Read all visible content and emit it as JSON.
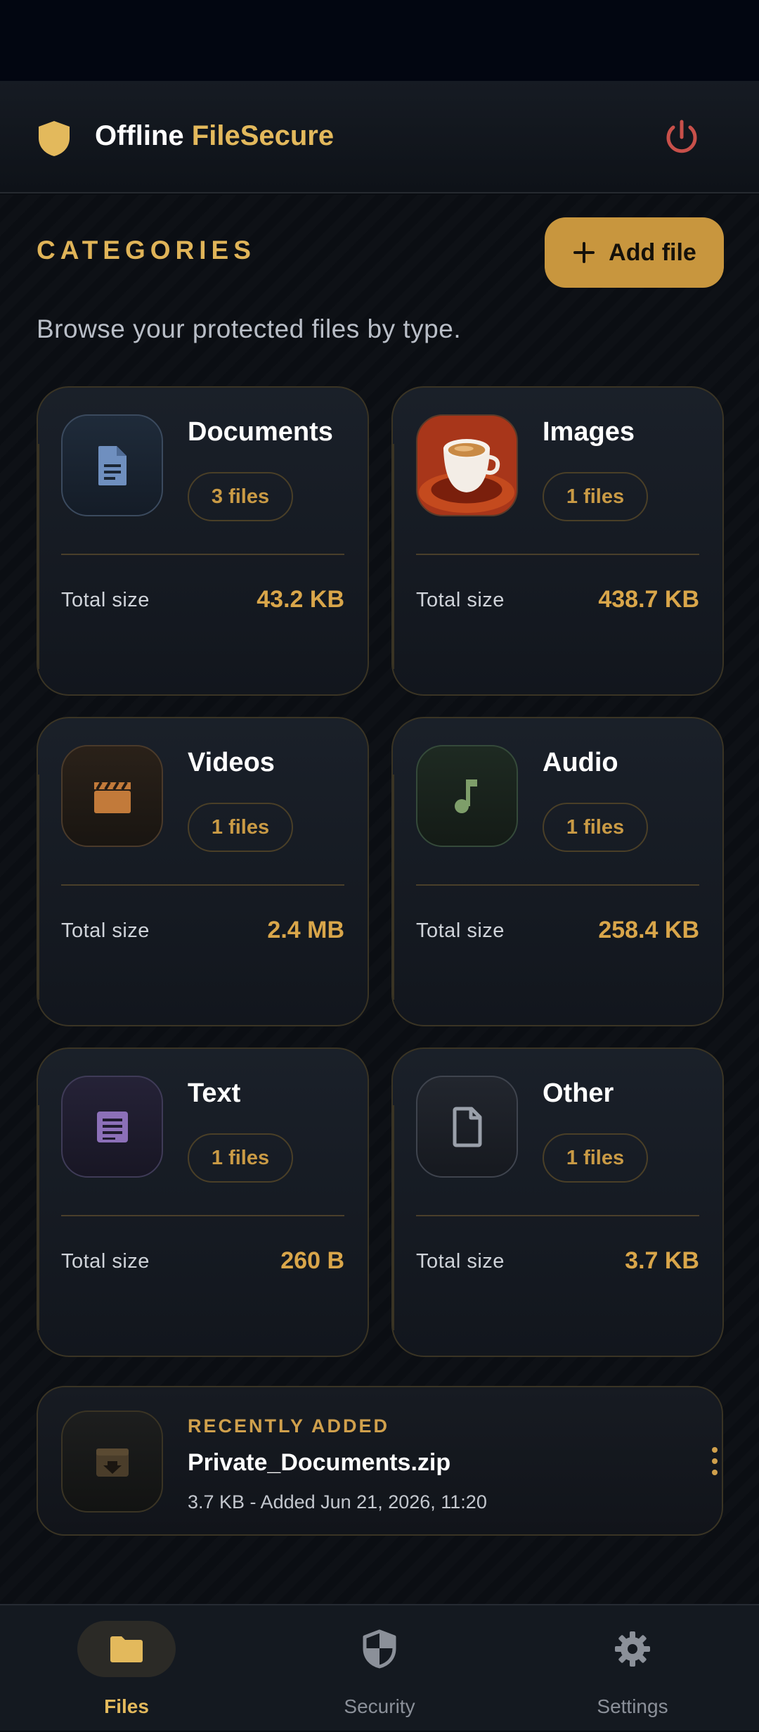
{
  "app": {
    "title_primary": "Offline",
    "title_accent": "FileSecure",
    "logo_icon": "shield-icon",
    "power_icon": "power-icon",
    "accent_color": "#e3b95c",
    "danger_color": "#c8504a"
  },
  "header": {
    "section_title": "CATEGORIES",
    "add_button_label": "Add file",
    "subtitle": "Browse your protected files by type."
  },
  "categories": [
    {
      "name": "Documents",
      "count": "3 files",
      "size_label": "Total size",
      "size": "43.2 KB",
      "icon": "document-icon"
    },
    {
      "name": "Images",
      "count": "1 files",
      "size_label": "Total size",
      "size": "438.7 KB",
      "icon": "image-thumbnail"
    },
    {
      "name": "Videos",
      "count": "1 files",
      "size_label": "Total size",
      "size": "2.4 MB",
      "icon": "clapperboard-icon"
    },
    {
      "name": "Audio",
      "count": "1 files",
      "size_label": "Total size",
      "size": "258.4 KB",
      "icon": "music-note-icon"
    },
    {
      "name": "Text",
      "count": "1 files",
      "size_label": "Total size",
      "size": "260 B",
      "icon": "text-file-icon"
    },
    {
      "name": "Other",
      "count": "1 files",
      "size_label": "Total size",
      "size": "3.7 KB",
      "icon": "file-icon"
    }
  ],
  "recent": {
    "label": "RECENTLY ADDED",
    "filename": "Private_Documents.zip",
    "meta": "3.7 KB - Added Jun 21, 2026, 11:20",
    "icon": "archive-icon"
  },
  "nav": {
    "items": [
      {
        "label": "Files",
        "icon": "folder-icon",
        "active": true
      },
      {
        "label": "Security",
        "icon": "shield-icon",
        "active": false
      },
      {
        "label": "Settings",
        "icon": "gear-icon",
        "active": false
      }
    ]
  }
}
